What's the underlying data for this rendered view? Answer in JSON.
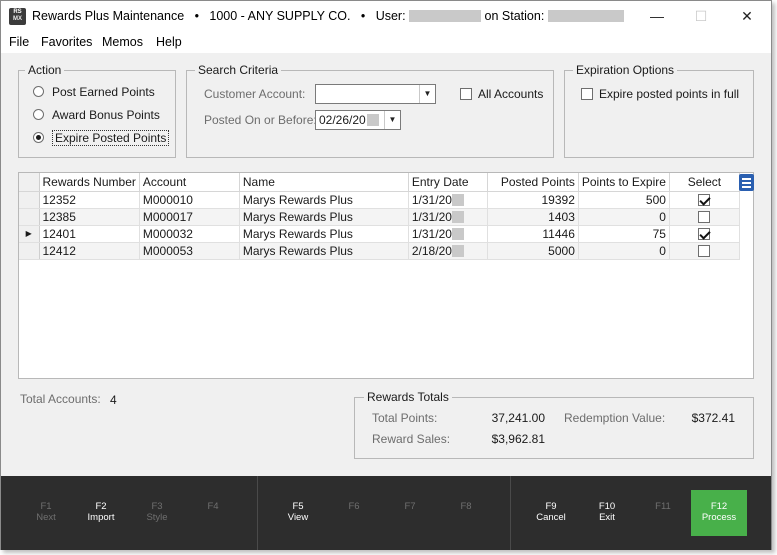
{
  "window": {
    "title": "Rewards Plus Maintenance",
    "separator": "•",
    "company": "1000 - ANY SUPPLY CO.",
    "user_label": "User:",
    "station_label": "on Station:",
    "logo_top": "RS",
    "logo_bottom": "MX",
    "minimize_icon": "—",
    "maximize_icon": "☐",
    "close_icon": "✕"
  },
  "menu": [
    "File",
    "Favorites",
    "Memos",
    "Help"
  ],
  "action": {
    "title": "Action",
    "options": [
      {
        "label": "Post Earned Points",
        "selected": false
      },
      {
        "label": "Award Bonus Points",
        "selected": false
      },
      {
        "label": "Expire Posted Points",
        "selected": true
      }
    ]
  },
  "search": {
    "title": "Search Criteria",
    "customer_account_label": "Customer Account:",
    "customer_account_value": "",
    "all_accounts_label": "All Accounts",
    "all_accounts_checked": false,
    "posted_on_label": "Posted On or Before:",
    "posted_on_value": "02/26/20"
  },
  "expiration": {
    "title": "Expiration Options",
    "expire_full_label": "Expire posted points in full",
    "expire_full_checked": false
  },
  "grid": {
    "columns": [
      "Rewards Number",
      "Account",
      "Name",
      "Entry Date",
      "Posted Points",
      "Points to Expire",
      "Select"
    ],
    "rows": [
      {
        "rewards_number": "12352",
        "account": "M000010",
        "name": "Marys Rewards Plus",
        "entry_date": "1/31/20",
        "posted_points": "19392",
        "points_to_expire": "500",
        "selected": true,
        "current": false
      },
      {
        "rewards_number": "12385",
        "account": "M000017",
        "name": "Marys Rewards Plus",
        "entry_date": "1/31/20",
        "posted_points": "1403",
        "points_to_expire": "0",
        "selected": false,
        "current": false
      },
      {
        "rewards_number": "12401",
        "account": "M000032",
        "name": "Marys Rewards Plus",
        "entry_date": "1/31/20",
        "posted_points": "11446",
        "points_to_expire": "75",
        "selected": true,
        "current": true
      },
      {
        "rewards_number": "12412",
        "account": "M000053",
        "name": "Marys Rewards Plus",
        "entry_date": "2/18/20",
        "posted_points": "5000",
        "points_to_expire": "0",
        "selected": false,
        "current": false
      }
    ],
    "current_row_icon": "▶",
    "menu_icon": "column-menu-icon"
  },
  "totals": {
    "total_accounts_label": "Total Accounts:",
    "total_accounts_value": "4",
    "title": "Rewards Totals",
    "total_points_label": "Total Points:",
    "total_points_value": "37,241.00",
    "redemption_value_label": "Redemption Value:",
    "redemption_value": "$372.41",
    "reward_sales_label": "Reward Sales:",
    "reward_sales_value": "$3,962.81"
  },
  "fkeys": [
    {
      "key": "F1",
      "label": "Next",
      "enabled": false
    },
    {
      "key": "F2",
      "label": "Import",
      "enabled": true
    },
    {
      "key": "F3",
      "label": "Style",
      "enabled": false
    },
    {
      "key": "F4",
      "label": "",
      "enabled": false
    },
    {
      "key": "F5",
      "label": "View",
      "enabled": true
    },
    {
      "key": "F6",
      "label": "",
      "enabled": false
    },
    {
      "key": "F7",
      "label": "",
      "enabled": false
    },
    {
      "key": "F8",
      "label": "",
      "enabled": false
    },
    {
      "key": "F9",
      "label": "Cancel",
      "enabled": true
    },
    {
      "key": "F10",
      "label": "Exit",
      "enabled": true
    },
    {
      "key": "F11",
      "label": "",
      "enabled": false
    },
    {
      "key": "F12",
      "label": "Process",
      "enabled": true
    }
  ],
  "colors": {
    "process_button": "#48b04a",
    "fkey_bar": "#2d2d2d",
    "grid_menu_icon": "#2a5fb0"
  }
}
